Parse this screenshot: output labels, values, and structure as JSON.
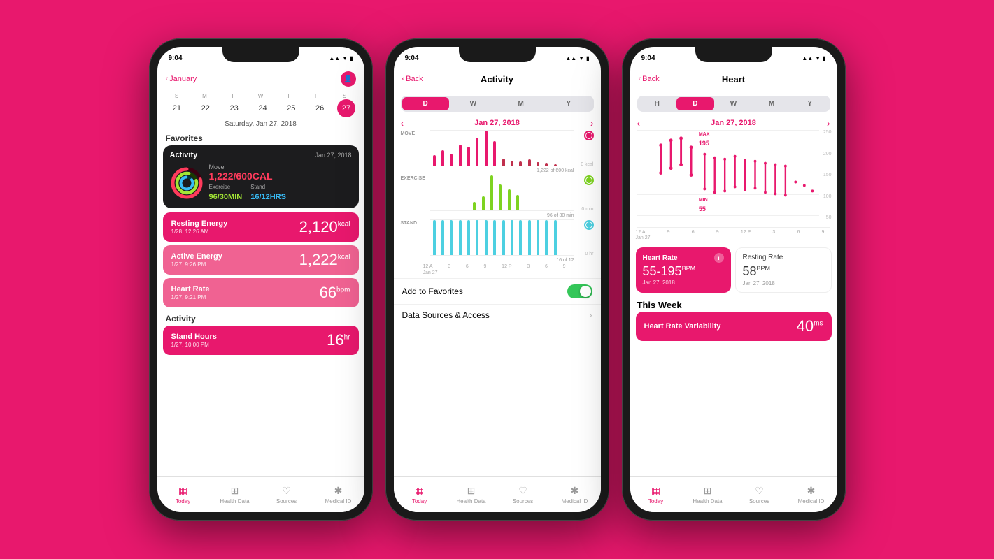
{
  "background": "#e8186d",
  "phone1": {
    "statusBar": {
      "time": "9:04",
      "icons": "▲ ▲ ◼"
    },
    "navMonth": "January",
    "navHasBack": true,
    "calDays": {
      "headers": [
        "S",
        "M",
        "T",
        "W",
        "T",
        "F",
        "S"
      ],
      "dates": [
        21,
        22,
        23,
        24,
        25,
        26,
        27
      ]
    },
    "dateLabel": "Saturday, Jan 27, 2018",
    "favoritesHeader": "Favorites",
    "activityCard": {
      "title": "Activity",
      "date": "Jan 27, 2018",
      "moveLabel": "Move",
      "moveValue": "1,222/600CAL",
      "exerciseLabel": "Exercise",
      "exerciseValue": "96/30MIN",
      "standLabel": "Stand",
      "standValue": "16/12HRS"
    },
    "metrics": [
      {
        "label": "Resting Energy",
        "sub": "1/28, 12:26 AM",
        "value": "2,120",
        "unit": "kcal",
        "color": "#e8186d"
      },
      {
        "label": "Active Energy",
        "sub": "1/27, 9:26 PM",
        "value": "1,222",
        "unit": "kcal",
        "color": "#f06292"
      },
      {
        "label": "Heart Rate",
        "sub": "1/27, 9:21 PM",
        "value": "66",
        "unit": "bpm",
        "color": "#f06292"
      }
    ],
    "activityHeader": "Activity",
    "standHours": {
      "label": "Stand Hours",
      "sub": "1/27, 10:00 PM",
      "value": "16",
      "unit": "hr"
    },
    "tabs": [
      {
        "icon": "▦",
        "label": "Today",
        "active": true
      },
      {
        "icon": "⊞",
        "label": "Health Data",
        "active": false
      },
      {
        "icon": "♡",
        "label": "Sources",
        "active": false
      },
      {
        "icon": "✱",
        "label": "Medical ID",
        "active": false
      }
    ]
  },
  "phone2": {
    "statusBar": {
      "time": "9:04"
    },
    "navBack": "Back",
    "navTitle": "Activity",
    "segments": [
      "D",
      "W",
      "M",
      "Y"
    ],
    "activeSegment": 0,
    "chartDate": "Jan 27, 2018",
    "sections": [
      {
        "label": "MOVE",
        "goal": "1,222 of 600 kcal",
        "color": "#e8186d"
      },
      {
        "label": "EXERCISE",
        "goal": "96 of 30 min",
        "color": "#7ed321"
      },
      {
        "label": "STAND",
        "goal": "16 of 12",
        "color": "#4dd0e1"
      }
    ],
    "timeLabels": [
      "12 A",
      "3",
      "6",
      "9",
      "12 P",
      "3",
      "6",
      "9"
    ],
    "dateLabelBottom": "Jan 27",
    "addToFavorites": "Add to Favorites",
    "toggleOn": true,
    "dataSourcesAccess": "Data Sources & Access",
    "tabs": [
      {
        "icon": "▦",
        "label": "Today",
        "active": true
      },
      {
        "icon": "⊞",
        "label": "Health Data",
        "active": false
      },
      {
        "icon": "♡",
        "label": "Sources",
        "active": false
      },
      {
        "icon": "✱",
        "label": "Medical ID",
        "active": false
      }
    ]
  },
  "phone3": {
    "statusBar": {
      "time": "9:04"
    },
    "navBack": "Back",
    "navTitle": "Heart",
    "segments": [
      "H",
      "D",
      "W",
      "M",
      "Y"
    ],
    "activeSegment": 1,
    "chartDate": "Jan 27, 2018",
    "maxLabel": "MAX",
    "maxValue": "195",
    "minLabel": "MIN",
    "minValue": "55",
    "yAxis": [
      "250",
      "200",
      "150",
      "100",
      "50"
    ],
    "dateLabelBottom": "Jan 27",
    "timeLabels": [
      "12 A",
      "9",
      "6",
      "9",
      "12 P",
      "3",
      "6",
      "9"
    ],
    "heartRateCard": {
      "title": "Heart Rate",
      "value": "55-195",
      "unit": "BPM",
      "date": "Jan 27, 2018"
    },
    "restingCard": {
      "title": "Resting Rate",
      "value": "58",
      "unit": "BPM",
      "date": "Jan 27, 2018"
    },
    "thisWeekHeader": "This Week",
    "hrvCard": {
      "label": "Heart Rate Variability",
      "value": "40",
      "unit": "ms"
    },
    "tabs": [
      {
        "icon": "▦",
        "label": "Today",
        "active": true
      },
      {
        "icon": "⊞",
        "label": "Health Data",
        "active": false
      },
      {
        "icon": "♡",
        "label": "Sources",
        "active": false
      },
      {
        "icon": "✱",
        "label": "Medical ID",
        "active": false
      }
    ]
  }
}
